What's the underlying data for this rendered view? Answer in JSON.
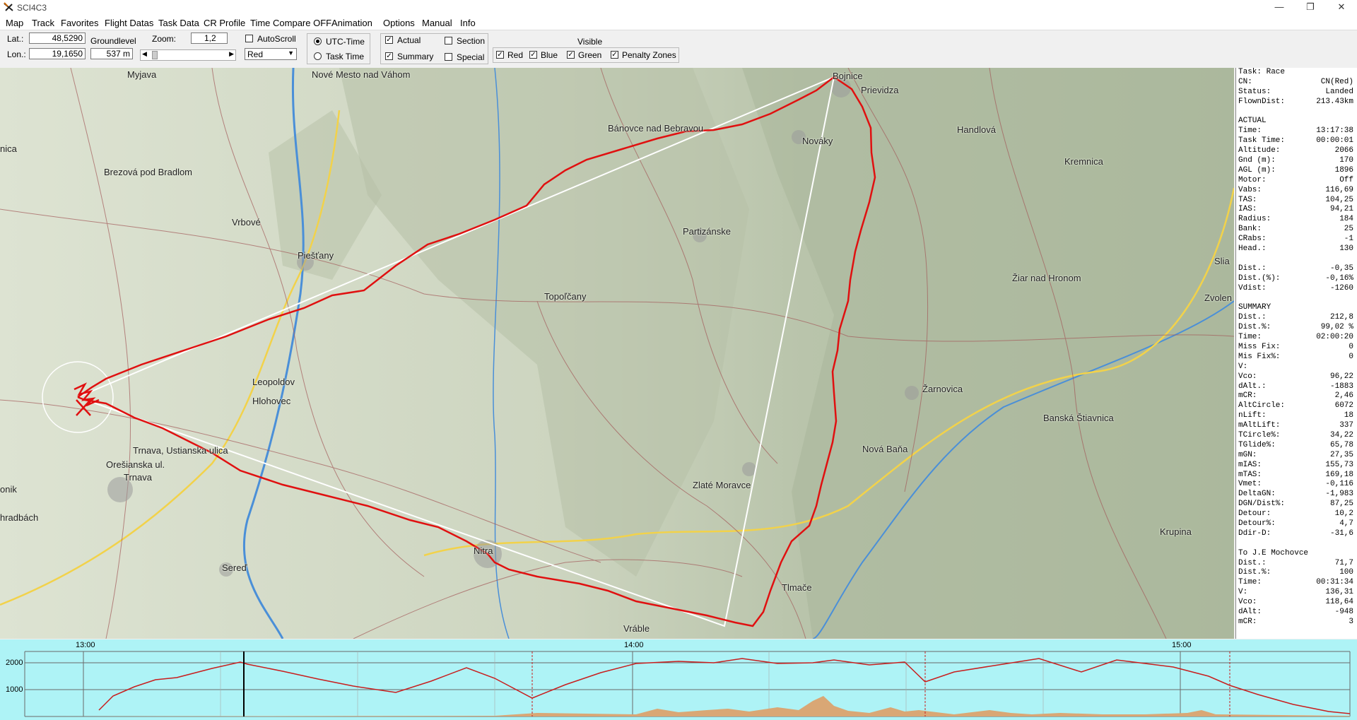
{
  "window": {
    "title": "SCI4C3"
  },
  "menu": [
    "Map",
    "Track",
    "Favorites",
    "Flight Datas",
    "Task Data",
    "CR Profile",
    "Time Compare OFF",
    "Animation",
    "Options",
    "Manual",
    "Info"
  ],
  "toolbar": {
    "lat_label": "Lat.:",
    "lat_value": "48,5290",
    "lon_label": "Lon.:",
    "lon_value": "19,1650",
    "groundlevel_label": "Groundlevel",
    "groundlevel_value": "537 m",
    "zoom_label": "Zoom:",
    "zoom_value": "1,2",
    "autoscroll_label": "AutoScroll",
    "color_select": "Red",
    "utc_label": "UTC-Time",
    "tasktime_label": "Task Time",
    "actual_label": "Actual",
    "summary_label": "Summary",
    "section_label": "Section",
    "special_label": "Special",
    "visible_label": "Visible",
    "red_label": "Red",
    "blue_label": "Blue",
    "green_label": "Green",
    "penalty_label": "Penalty Zones"
  },
  "map": {
    "towns": [
      "Myjava",
      "Nové Mesto nad Váhom",
      "Bojnice",
      "Prievidza",
      "Bánovce nad Bebravou",
      "Nováky",
      "Handlová",
      "Kremnica",
      "nica",
      "Brezová pod Bradlom",
      "Vrbové",
      "Partizánske",
      "Piešťany",
      "Topoľčany",
      "Žiar nad Hronom",
      "Zvolen",
      "Slia",
      "Leopoldov",
      "Hlohovec",
      "Žarnovica",
      "Banská Štiavnica",
      "Trnava, Ustianska ulica",
      "Orešianska ul.",
      "Trnava",
      "Nová Baňa",
      "Zlaté Moravce",
      "onik",
      "hradbách",
      "Sereď",
      "Nitra",
      "Tlmače",
      "Krupina",
      "Vráble"
    ]
  },
  "panel": [
    {
      "k": "Task: Race",
      "v": ""
    },
    {
      "k": "CN:",
      "v": "CN(Red)"
    },
    {
      "k": "Status:",
      "v": "Landed"
    },
    {
      "k": "FlownDist:",
      "v": "213.43km"
    },
    {
      "k": "",
      "v": ""
    },
    {
      "k": "ACTUAL",
      "v": ""
    },
    {
      "k": "Time:",
      "v": "13:17:38"
    },
    {
      "k": "Task Time:",
      "v": "00:00:01"
    },
    {
      "k": "Altitude:",
      "v": "2066"
    },
    {
      "k": "Gnd (m):",
      "v": "170"
    },
    {
      "k": "AGL (m):",
      "v": "1896"
    },
    {
      "k": "Motor:",
      "v": "Off"
    },
    {
      "k": "Vabs:",
      "v": "116,69"
    },
    {
      "k": "TAS:",
      "v": "104,25"
    },
    {
      "k": "IAS:",
      "v": "94,21"
    },
    {
      "k": "Radius:",
      "v": "184"
    },
    {
      "k": "Bank:",
      "v": "25"
    },
    {
      "k": "CRabs:",
      "v": "-1"
    },
    {
      "k": "Head.:",
      "v": "130"
    },
    {
      "k": "",
      "v": ""
    },
    {
      "k": "Dist.:",
      "v": "-0,35"
    },
    {
      "k": "Dist.(%):",
      "v": "-0,16%"
    },
    {
      "k": "Vdist:",
      "v": "-1260"
    },
    {
      "k": "",
      "v": ""
    },
    {
      "k": "SUMMARY",
      "v": ""
    },
    {
      "k": "Dist.:",
      "v": "212,8"
    },
    {
      "k": "Dist.%:",
      "v": "99,02 %"
    },
    {
      "k": "Time:",
      "v": "02:00:20"
    },
    {
      "k": "Miss Fix:",
      "v": "0"
    },
    {
      "k": "Mis Fix%:",
      "v": "0"
    },
    {
      "k": "V:",
      "v": ""
    },
    {
      "k": "Vco:",
      "v": "96,22"
    },
    {
      "k": "dAlt.:",
      "v": "-1883"
    },
    {
      "k": "mCR:",
      "v": "2,46"
    },
    {
      "k": "AltCircle:",
      "v": "6072"
    },
    {
      "k": "nLift:",
      "v": "18"
    },
    {
      "k": "mAltLift:",
      "v": "337"
    },
    {
      "k": "TCircle%:",
      "v": "34,22"
    },
    {
      "k": "TGlide%:",
      "v": "65,78"
    },
    {
      "k": "mGN:",
      "v": "27,35"
    },
    {
      "k": "mIAS:",
      "v": "155,73"
    },
    {
      "k": "mTAS:",
      "v": "169,18"
    },
    {
      "k": "Vmet:",
      "v": "-0,116"
    },
    {
      "k": "DeltaGN:",
      "v": "-1,983"
    },
    {
      "k": "DGN/Dist%:",
      "v": "87,25"
    },
    {
      "k": "Detour:",
      "v": "10,2"
    },
    {
      "k": "Detour%:",
      "v": "4,7"
    },
    {
      "k": "Ddir-D:",
      "v": "-31,6"
    },
    {
      "k": "",
      "v": ""
    },
    {
      "k": "To J.E Mochovce",
      "v": ""
    },
    {
      "k": "Dist.:",
      "v": "71,7"
    },
    {
      "k": "Dist.%:",
      "v": "100"
    },
    {
      "k": "Time:",
      "v": "00:31:34"
    },
    {
      "k": "V:",
      "v": "136,31"
    },
    {
      "k": "Vco:",
      "v": "118,64"
    },
    {
      "k": "dAlt:",
      "v": "-948"
    },
    {
      "k": "mCR:",
      "v": "3"
    }
  ],
  "graph": {
    "time_labels": [
      "13:00",
      "14:00",
      "15:00"
    ],
    "y_labels": [
      "2000",
      "1000"
    ]
  },
  "colors": {
    "track": "#e01010",
    "task": "#ffffff",
    "graph_bg": "#aef3f6",
    "terrain": "#d9a775",
    "altitude": "#c81e1e"
  }
}
